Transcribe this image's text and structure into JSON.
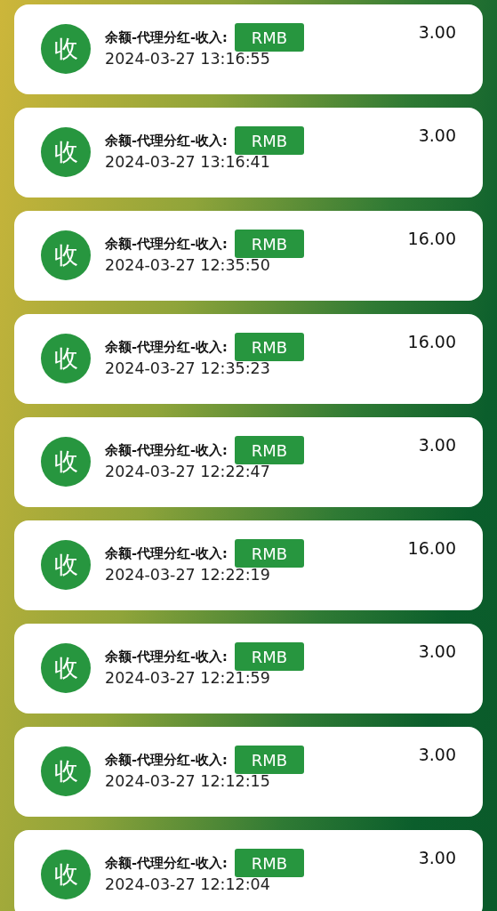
{
  "records": [
    {
      "icon": "收",
      "title": "余额-代理分红-收入:",
      "currency": "RMB",
      "time": "2024-03-27 13:16:55",
      "amount": "3.00"
    },
    {
      "icon": "收",
      "title": "余额-代理分红-收入:",
      "currency": "RMB",
      "time": "2024-03-27 13:16:41",
      "amount": "3.00"
    },
    {
      "icon": "收",
      "title": "余额-代理分红-收入:",
      "currency": "RMB",
      "time": "2024-03-27 12:35:50",
      "amount": "16.00"
    },
    {
      "icon": "收",
      "title": "余额-代理分红-收入:",
      "currency": "RMB",
      "time": "2024-03-27 12:35:23",
      "amount": "16.00"
    },
    {
      "icon": "收",
      "title": "余额-代理分红-收入:",
      "currency": "RMB",
      "time": "2024-03-27 12:22:47",
      "amount": "3.00"
    },
    {
      "icon": "收",
      "title": "余额-代理分红-收入:",
      "currency": "RMB",
      "time": "2024-03-27 12:22:19",
      "amount": "16.00"
    },
    {
      "icon": "收",
      "title": "余额-代理分红-收入:",
      "currency": "RMB",
      "time": "2024-03-27 12:21:59",
      "amount": "3.00"
    },
    {
      "icon": "收",
      "title": "余额-代理分红-收入:",
      "currency": "RMB",
      "time": "2024-03-27 12:12:15",
      "amount": "3.00"
    },
    {
      "icon": "收",
      "title": "余额-代理分红-收入:",
      "currency": "RMB",
      "time": "2024-03-27 12:12:04",
      "amount": "3.00"
    }
  ]
}
